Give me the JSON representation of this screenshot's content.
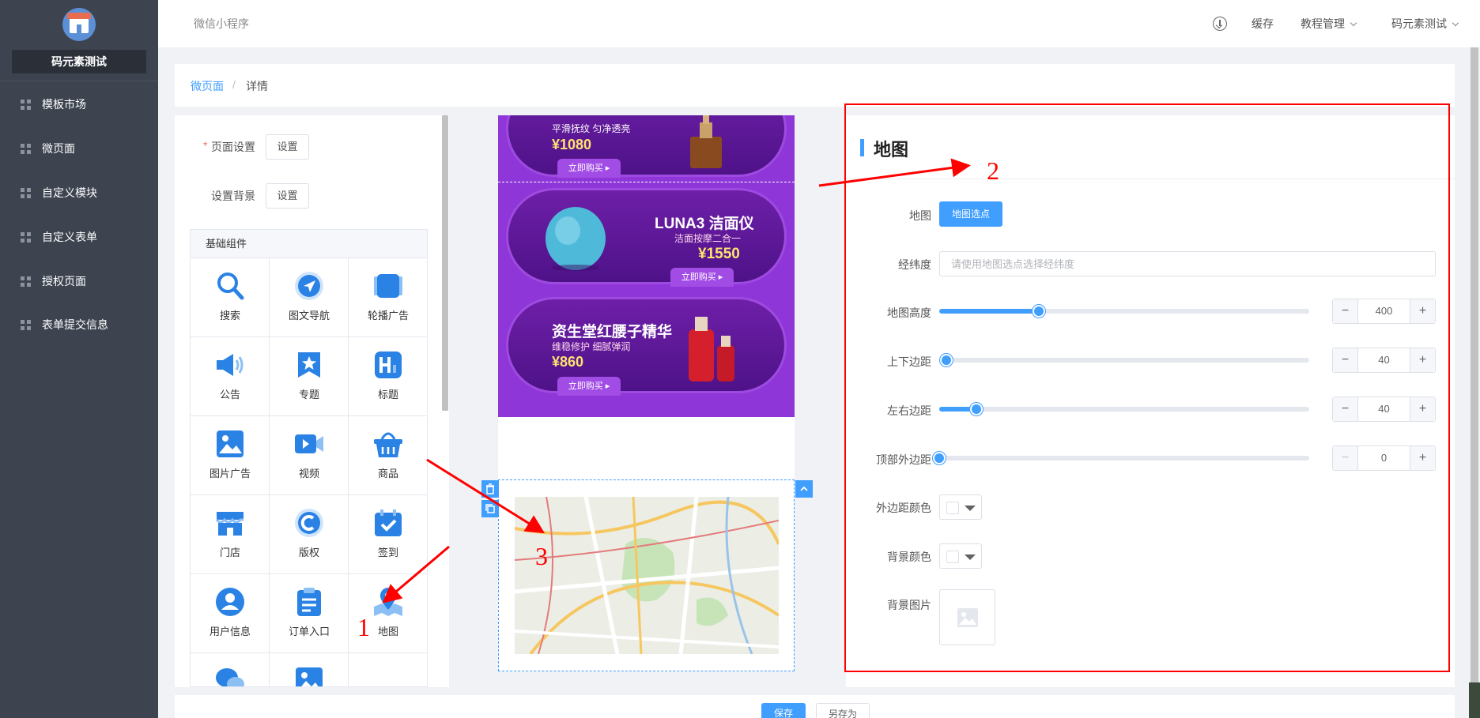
{
  "sidebar": {
    "shop_name": "码元素测试",
    "items": [
      {
        "label": "模板市场"
      },
      {
        "label": "微页面"
      },
      {
        "label": "自定义模块"
      },
      {
        "label": "自定义表单"
      },
      {
        "label": "授权页面"
      },
      {
        "label": "表单提交信息"
      }
    ]
  },
  "topbar": {
    "app_name": "微信小程序",
    "cache_label": "缓存",
    "tutorial_label": "教程管理",
    "user_label": "码元素测试"
  },
  "breadcrumb": {
    "parent": "微页面",
    "separator": "/",
    "current": "详情"
  },
  "components": {
    "page_settings_label": "页面设置",
    "bg_settings_label": "设置背景",
    "settings_button": "设置",
    "group_title": "基础组件",
    "items": [
      {
        "label": "搜索",
        "icon": "search-icon"
      },
      {
        "label": "图文导航",
        "icon": "navigation-icon"
      },
      {
        "label": "轮播广告",
        "icon": "carousel-icon"
      },
      {
        "label": "公告",
        "icon": "speaker-icon"
      },
      {
        "label": "专题",
        "icon": "star-bookmark-icon"
      },
      {
        "label": "标题",
        "icon": "heading-icon"
      },
      {
        "label": "图片广告",
        "icon": "image-icon"
      },
      {
        "label": "视频",
        "icon": "video-icon"
      },
      {
        "label": "商品",
        "icon": "basket-icon"
      },
      {
        "label": "门店",
        "icon": "store-icon"
      },
      {
        "label": "版权",
        "icon": "copyright-icon"
      },
      {
        "label": "签到",
        "icon": "calendar-check-icon"
      },
      {
        "label": "用户信息",
        "icon": "user-icon"
      },
      {
        "label": "订单入口",
        "icon": "clipboard-icon"
      },
      {
        "label": "地图",
        "icon": "map-pin-icon"
      },
      {
        "label": "",
        "icon": "chat-icon"
      },
      {
        "label": "",
        "icon": "picture-icon"
      }
    ]
  },
  "preview": {
    "promo1": {
      "subtitle": "平滑抚纹 匀净透亮",
      "price": "¥1080",
      "button": "立即购买 ▸"
    },
    "promo2": {
      "title": "LUNA3 洁面仪",
      "subtitle": "洁面按摩二合一",
      "price": "¥1550",
      "button": "立即购买 ▸"
    },
    "promo3": {
      "title": "资生堂红腰子精华",
      "subtitle": "维稳修护 细腻弹润",
      "price": "¥860",
      "button": "立即购买 ▸"
    }
  },
  "settings": {
    "title": "地图",
    "map_label": "地图",
    "map_button": "地图选点",
    "latlng_label": "经纬度",
    "latlng_placeholder": "请使用地图选点选择经纬度",
    "latlng_value": "",
    "height": {
      "label": "地图高度",
      "value": "400",
      "fraction": 0.27
    },
    "vertical_margin": {
      "label": "上下边距",
      "value": "40",
      "fraction": 0.02
    },
    "horizontal_margin": {
      "label": "左右边距",
      "value": "40",
      "fraction": 0.1
    },
    "top_margin": {
      "label": "顶部外边距",
      "value": "0",
      "fraction": 0
    },
    "margin_color_label": "外边距颜色",
    "bg_color_label": "背景颜色",
    "bg_image_label": "背景图片"
  },
  "annotations": {
    "one": "1",
    "two": "2",
    "three": "3"
  },
  "footer": {
    "save": "保存",
    "save_as": "另存为"
  },
  "colors": {
    "accent": "#409eff",
    "sidebar": "#3d4450",
    "annotation": "#ff0000",
    "promo_bg": "#8e36d8"
  }
}
